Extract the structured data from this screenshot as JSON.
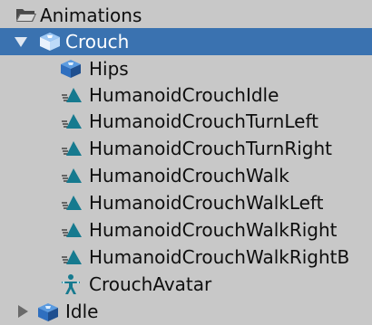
{
  "hierarchy": {
    "root_label": "Animations",
    "crouch_label": "Crouch",
    "children": [
      {
        "label": "Hips",
        "icon": "prefab-cube-icon"
      },
      {
        "label": "HumanoidCrouchIdle",
        "icon": "animation-clip-icon"
      },
      {
        "label": "HumanoidCrouchTurnLeft",
        "icon": "animation-clip-icon"
      },
      {
        "label": "HumanoidCrouchTurnRight",
        "icon": "animation-clip-icon"
      },
      {
        "label": "HumanoidCrouchWalk",
        "icon": "animation-clip-icon"
      },
      {
        "label": "HumanoidCrouchWalkLeft",
        "icon": "animation-clip-icon"
      },
      {
        "label": "HumanoidCrouchWalkRight",
        "icon": "animation-clip-icon"
      },
      {
        "label": "HumanoidCrouchWalkRightB",
        "icon": "animation-clip-icon"
      },
      {
        "label": "CrouchAvatar",
        "icon": "avatar-icon"
      }
    ],
    "idle_label": "Idle"
  },
  "colors": {
    "background": "#c8c8c8",
    "selection": "#3a72b0",
    "clip_icon": "#167a8f",
    "cube_icon": "#3b7fd0"
  }
}
